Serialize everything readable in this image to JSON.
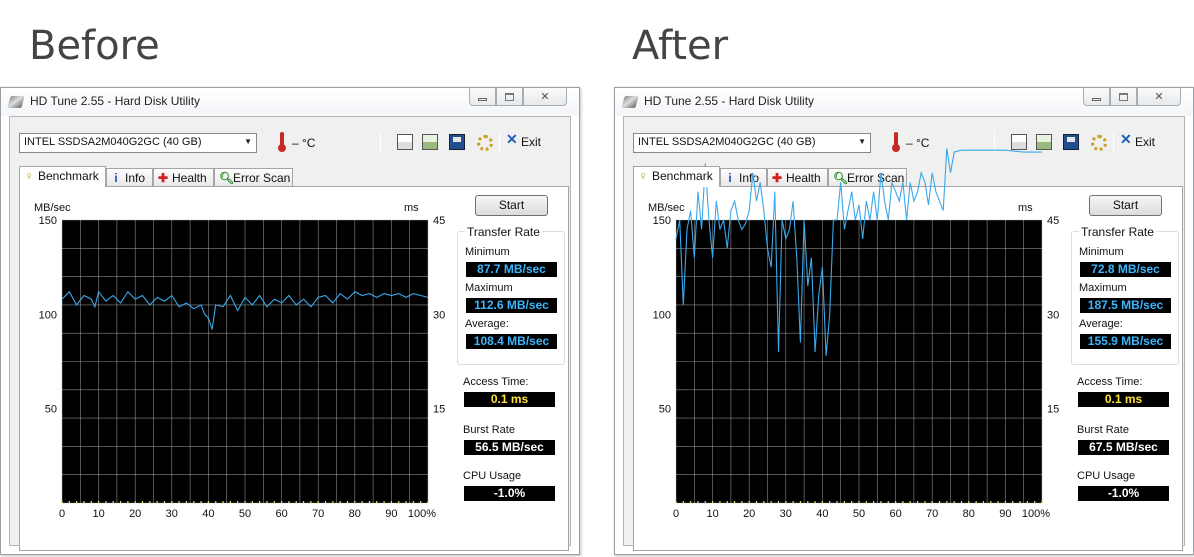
{
  "panels": [
    {
      "heading": "Before",
      "window_title": "HD Tune 2.55 - Hard Disk Utility",
      "drive": "INTEL SSDSA2M040G2GC (40 GB)",
      "temperature": "– °C",
      "exit_label": "Exit",
      "tabs": [
        "Benchmark",
        "Info",
        "Health",
        "Error Scan"
      ],
      "start_label": "Start",
      "transfer_rate_title": "Transfer Rate",
      "min_label": "Minimum",
      "min_value": "87.7 MB/sec",
      "max_label": "Maximum",
      "max_value": "112.6 MB/sec",
      "avg_label": "Average:",
      "avg_value": "108.4 MB/sec",
      "access_label": "Access Time:",
      "access_value": "0.1 ms",
      "burst_label": "Burst Rate",
      "burst_value": "56.5 MB/sec",
      "cpu_label": "CPU Usage",
      "cpu_value": "-1.0%"
    },
    {
      "heading": "After",
      "window_title": "HD Tune 2.55 - Hard Disk Utility",
      "drive": "INTEL SSDSA2M040G2GC (40 GB)",
      "temperature": "– °C",
      "exit_label": "Exit",
      "tabs": [
        "Benchmark",
        "Info",
        "Health",
        "Error Scan"
      ],
      "start_label": "Start",
      "transfer_rate_title": "Transfer Rate",
      "min_label": "Minimum",
      "min_value": "72.8 MB/sec",
      "max_label": "Maximum",
      "max_value": "187.5 MB/sec",
      "avg_label": "Average:",
      "avg_value": "155.9 MB/sec",
      "access_label": "Access Time:",
      "access_value": "0.1 ms",
      "burst_label": "Burst Rate",
      "burst_value": "67.5 MB/sec",
      "cpu_label": "CPU Usage",
      "cpu_value": "-1.0%"
    }
  ],
  "colors": {
    "plot_bg": "#000000",
    "grid": "#b8b8b8",
    "transfer_line": "#3aa8ea",
    "access_marks": "#e8e05a"
  },
  "icons": [
    "app-disk-icon",
    "thermometer-icon",
    "copy-text-icon",
    "copy-screenshot-icon",
    "save-icon",
    "options-icon",
    "exit-icon",
    "benchmark-icon",
    "info-icon",
    "health-icon",
    "error-scan-icon"
  ],
  "chart_data": [
    {
      "type": "line",
      "x_unit": "%",
      "xlim": [
        0,
        100
      ],
      "x_ticks": [
        "0",
        "10",
        "20",
        "30",
        "40",
        "50",
        "60",
        "70",
        "80",
        "90",
        "100%"
      ],
      "y_left_label": "MB/sec",
      "y_left_ticks": [
        "150",
        "100",
        "50"
      ],
      "ylim": [
        0,
        150
      ],
      "y_right_label": "ms",
      "y_right_ticks": [
        "45",
        "30",
        "15"
      ],
      "y2lim": [
        0,
        45
      ],
      "grid": true,
      "series": [
        {
          "x": [
            0,
            2,
            4,
            6,
            8,
            9,
            10,
            12,
            14,
            16,
            18,
            20,
            22,
            24,
            26,
            28,
            30,
            32,
            34,
            36,
            38,
            39,
            40,
            41,
            42,
            44,
            46,
            48,
            50,
            52,
            54,
            56,
            58,
            60,
            62,
            64,
            66,
            68,
            70,
            72,
            74,
            76,
            78,
            80,
            82,
            84,
            86,
            88,
            90,
            92,
            94,
            96,
            98,
            100
          ],
          "y": [
            108,
            112,
            105,
            110,
            108,
            104,
            112,
            107,
            110,
            106,
            112,
            108,
            110,
            105,
            109,
            107,
            110,
            104,
            106,
            103,
            105,
            100,
            98,
            92,
            105,
            104,
            110,
            102,
            109,
            105,
            110,
            104,
            108,
            106,
            110,
            105,
            108,
            104,
            109,
            110,
            106,
            111,
            108,
            112,
            110,
            111,
            109,
            111,
            110,
            111,
            109,
            111,
            110,
            109
          ]
        },
        {
          "x": [
            0,
            1,
            2,
            3,
            4,
            5,
            6,
            7,
            8,
            9,
            10,
            11,
            12,
            13,
            14,
            15,
            16,
            17,
            18,
            19,
            20,
            21,
            22,
            23,
            24,
            25,
            26,
            27,
            28,
            29,
            30,
            31,
            32,
            33,
            34,
            35,
            36,
            37,
            38,
            39,
            40,
            41,
            42,
            43,
            44,
            45,
            46,
            47,
            48,
            49,
            50,
            51,
            52,
            53,
            54,
            55,
            56,
            57,
            58,
            59,
            60,
            61,
            62,
            63,
            64,
            65,
            66,
            67,
            68,
            69,
            70,
            71,
            72,
            73,
            74,
            75,
            76,
            78,
            80,
            85,
            90,
            95,
            100
          ],
          "y": [
            140,
            150,
            105,
            145,
            155,
            130,
            165,
            145,
            180,
            150,
            130,
            160,
            145,
            150,
            135,
            155,
            160,
            150,
            145,
            148,
            155,
            175,
            160,
            170,
            155,
            135,
            125,
            165,
            80,
            150,
            140,
            145,
            160,
            130,
            85,
            150,
            115,
            130,
            80,
            110,
            125,
            78,
            100,
            150,
            150,
            170,
            145,
            155,
            165,
            150,
            158,
            140,
            160,
            150,
            165,
            150,
            175,
            160,
            150,
            170,
            165,
            160,
            170,
            150,
            170,
            160,
            165,
            175,
            170,
            158,
            175,
            165,
            160,
            155,
            188,
            175,
            186,
            187,
            187,
            187,
            187,
            186,
            186
          ]
        }
      ]
    }
  ]
}
